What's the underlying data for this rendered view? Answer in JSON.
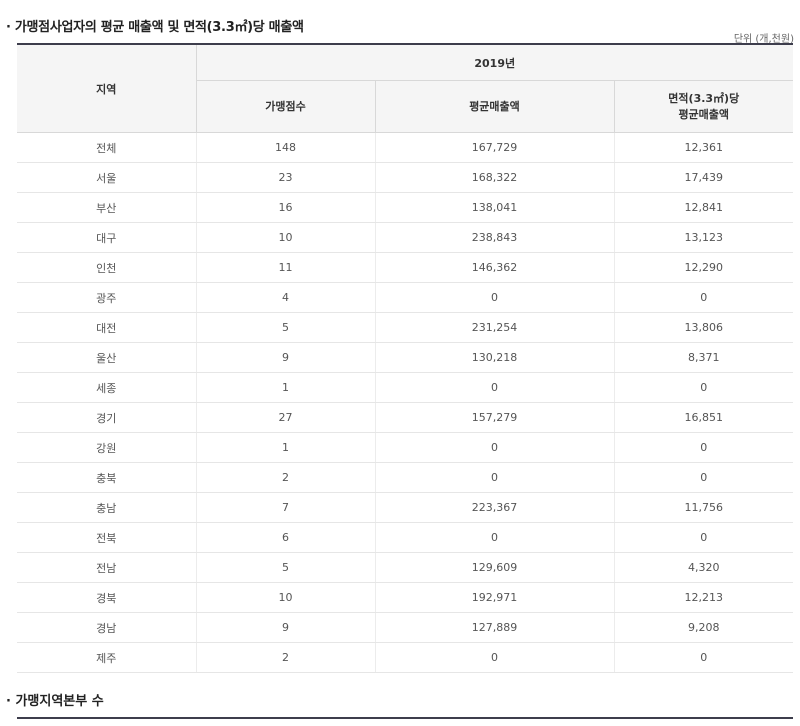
{
  "section1": {
    "title": "· 가맹점사업자의 평균 매출액 및 면적(3.3㎡)당 매출액",
    "unit": "단위 (개,천원)"
  },
  "table": {
    "header": {
      "region": "지역",
      "year": "2019년",
      "col_count": "가맹점수",
      "col_avg_sales": "평균매출액",
      "col_area_sales_line1": "면적(3.3㎡)당",
      "col_area_sales_line2": "평균매출액"
    },
    "rows": [
      {
        "region": "전체",
        "count": "148",
        "avg_sales": "167,729",
        "area_sales": "12,361"
      },
      {
        "region": "서울",
        "count": "23",
        "avg_sales": "168,322",
        "area_sales": "17,439"
      },
      {
        "region": "부산",
        "count": "16",
        "avg_sales": "138,041",
        "area_sales": "12,841"
      },
      {
        "region": "대구",
        "count": "10",
        "avg_sales": "238,843",
        "area_sales": "13,123"
      },
      {
        "region": "인천",
        "count": "11",
        "avg_sales": "146,362",
        "area_sales": "12,290"
      },
      {
        "region": "광주",
        "count": "4",
        "avg_sales": "0",
        "area_sales": "0"
      },
      {
        "region": "대전",
        "count": "5",
        "avg_sales": "231,254",
        "area_sales": "13,806"
      },
      {
        "region": "울산",
        "count": "9",
        "avg_sales": "130,218",
        "area_sales": "8,371"
      },
      {
        "region": "세종",
        "count": "1",
        "avg_sales": "0",
        "area_sales": "0"
      },
      {
        "region": "경기",
        "count": "27",
        "avg_sales": "157,279",
        "area_sales": "16,851"
      },
      {
        "region": "강원",
        "count": "1",
        "avg_sales": "0",
        "area_sales": "0"
      },
      {
        "region": "충북",
        "count": "2",
        "avg_sales": "0",
        "area_sales": "0"
      },
      {
        "region": "충남",
        "count": "7",
        "avg_sales": "223,367",
        "area_sales": "11,756"
      },
      {
        "region": "전북",
        "count": "6",
        "avg_sales": "0",
        "area_sales": "0"
      },
      {
        "region": "전남",
        "count": "5",
        "avg_sales": "129,609",
        "area_sales": "4,320"
      },
      {
        "region": "경북",
        "count": "10",
        "avg_sales": "192,971",
        "area_sales": "12,213"
      },
      {
        "region": "경남",
        "count": "9",
        "avg_sales": "127,889",
        "area_sales": "9,208"
      },
      {
        "region": "제주",
        "count": "2",
        "avg_sales": "0",
        "area_sales": "0"
      }
    ]
  },
  "section2": {
    "title": "· 가맹지역본부 수"
  }
}
